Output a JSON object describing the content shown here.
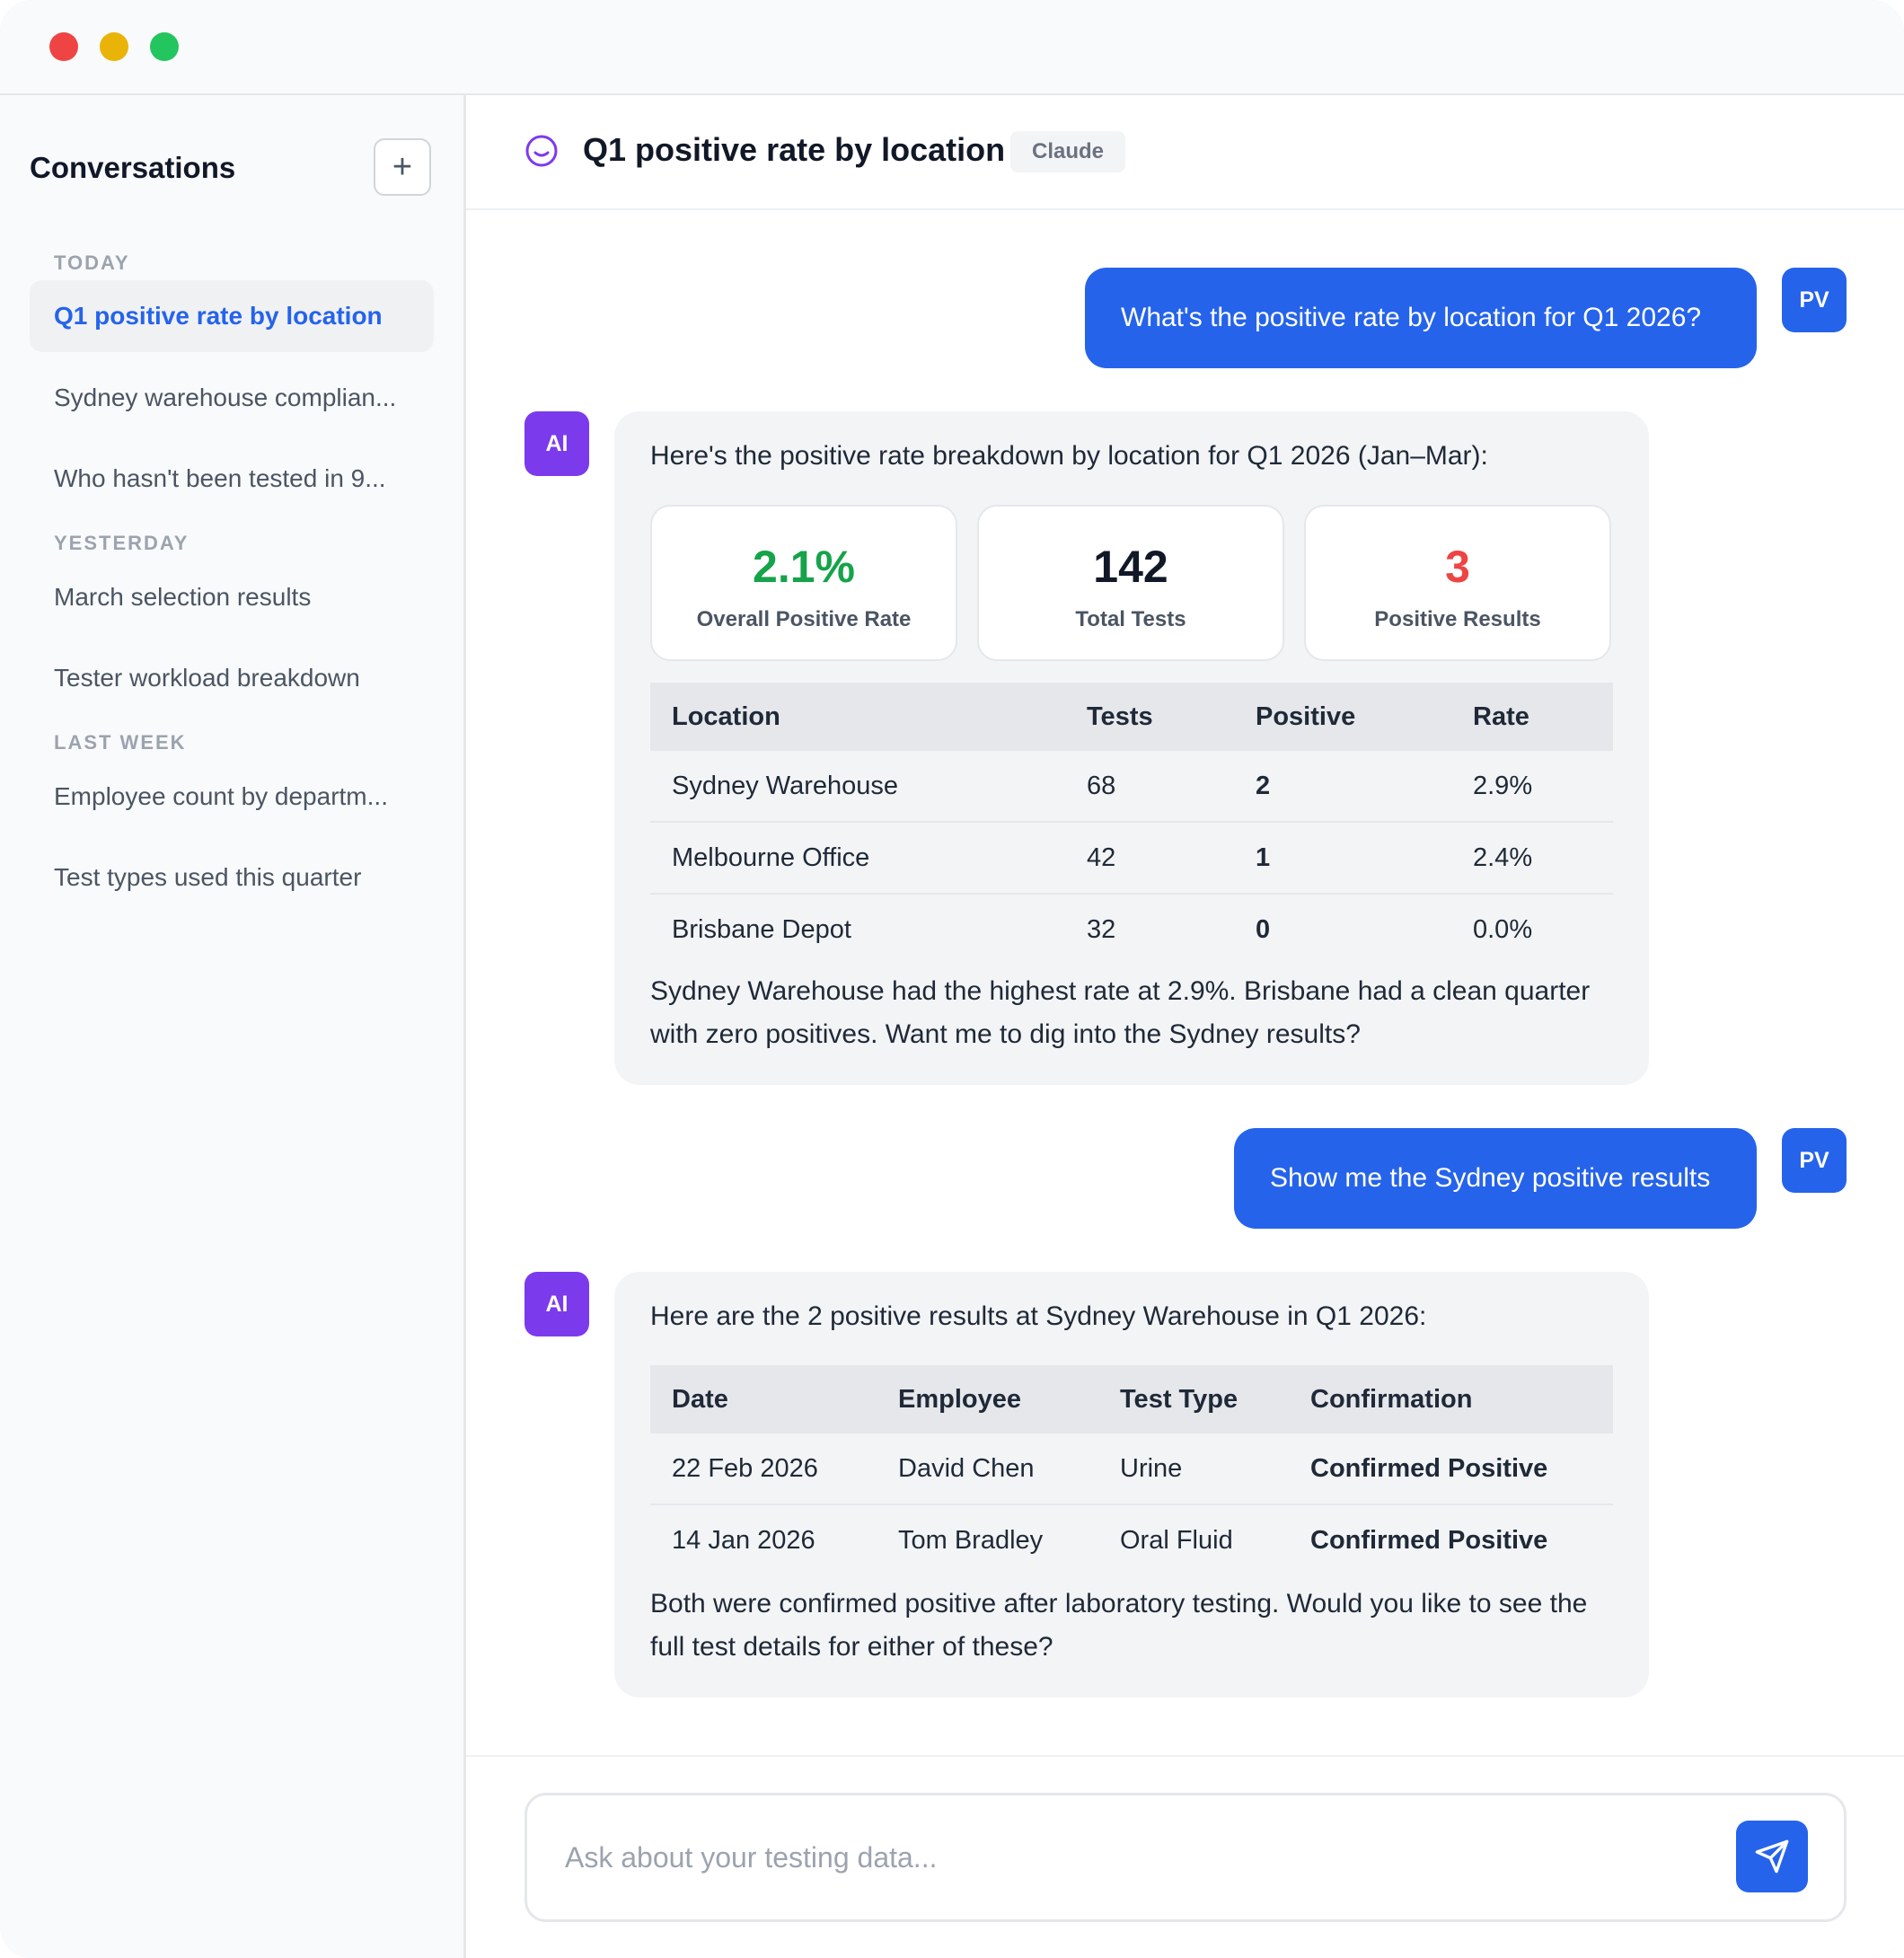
{
  "sidebar": {
    "title": "Conversations",
    "new_label": "+",
    "groups": [
      {
        "label": "TODAY",
        "items": [
          "Q1 positive rate by location",
          "Sydney warehouse complian...",
          "Who hasn't been tested in 9..."
        ]
      },
      {
        "label": "YESTERDAY",
        "items": [
          "March selection results",
          "Tester workload breakdown"
        ]
      },
      {
        "label": "LAST WEEK",
        "items": [
          "Employee count by departm...",
          "Test types used this quarter"
        ]
      }
    ]
  },
  "header": {
    "title": "Q1 positive rate by location",
    "model": "Claude"
  },
  "messages": {
    "user1": {
      "avatar": "PV",
      "text": "What's the positive rate by location for Q1 2026?"
    },
    "ai1": {
      "avatar": "AI",
      "intro": "Here's the positive rate breakdown by location for Q1 2026 (Jan–Mar):",
      "stats": [
        {
          "value": "2.1%",
          "label": "Overall Positive Rate",
          "color": "#16a34a"
        },
        {
          "value": "142",
          "label": "Total Tests",
          "color": "#111827"
        },
        {
          "value": "3",
          "label": "Positive Results",
          "color": "#ef4444"
        }
      ],
      "table": {
        "headers": [
          "Location",
          "Tests",
          "Positive",
          "Rate"
        ],
        "rows": [
          [
            "Sydney Warehouse",
            "68",
            "2",
            "2.9%"
          ],
          [
            "Melbourne Office",
            "42",
            "1",
            "2.4%"
          ],
          [
            "Brisbane Depot",
            "32",
            "0",
            "0.0%"
          ]
        ]
      },
      "outro": "Sydney Warehouse had the highest rate at 2.9%. Brisbane had a clean quarter with zero positives. Want me to dig into the Sydney results?"
    },
    "user2": {
      "avatar": "PV",
      "text": "Show me the Sydney positive results"
    },
    "ai2": {
      "avatar": "AI",
      "intro": "Here are the 2 positive results at Sydney Warehouse in Q1 2026:",
      "table": {
        "headers": [
          "Date",
          "Employee",
          "Test Type",
          "Confirmation"
        ],
        "rows": [
          [
            "22 Feb 2026",
            "David Chen",
            "Urine",
            "Confirmed Positive"
          ],
          [
            "14 Jan 2026",
            "Tom Bradley",
            "Oral Fluid",
            "Confirmed Positive"
          ]
        ]
      },
      "outro": "Both were confirmed positive after laboratory testing. Would you like to see the full test details for either of these?"
    }
  },
  "composer": {
    "placeholder": "Ask about your testing data...",
    "value": ""
  },
  "colors": {
    "accent": "#2563eb",
    "ai_avatar": "#7c3aed",
    "positive_green": "#16a34a",
    "positive_red": "#ef4444"
  }
}
